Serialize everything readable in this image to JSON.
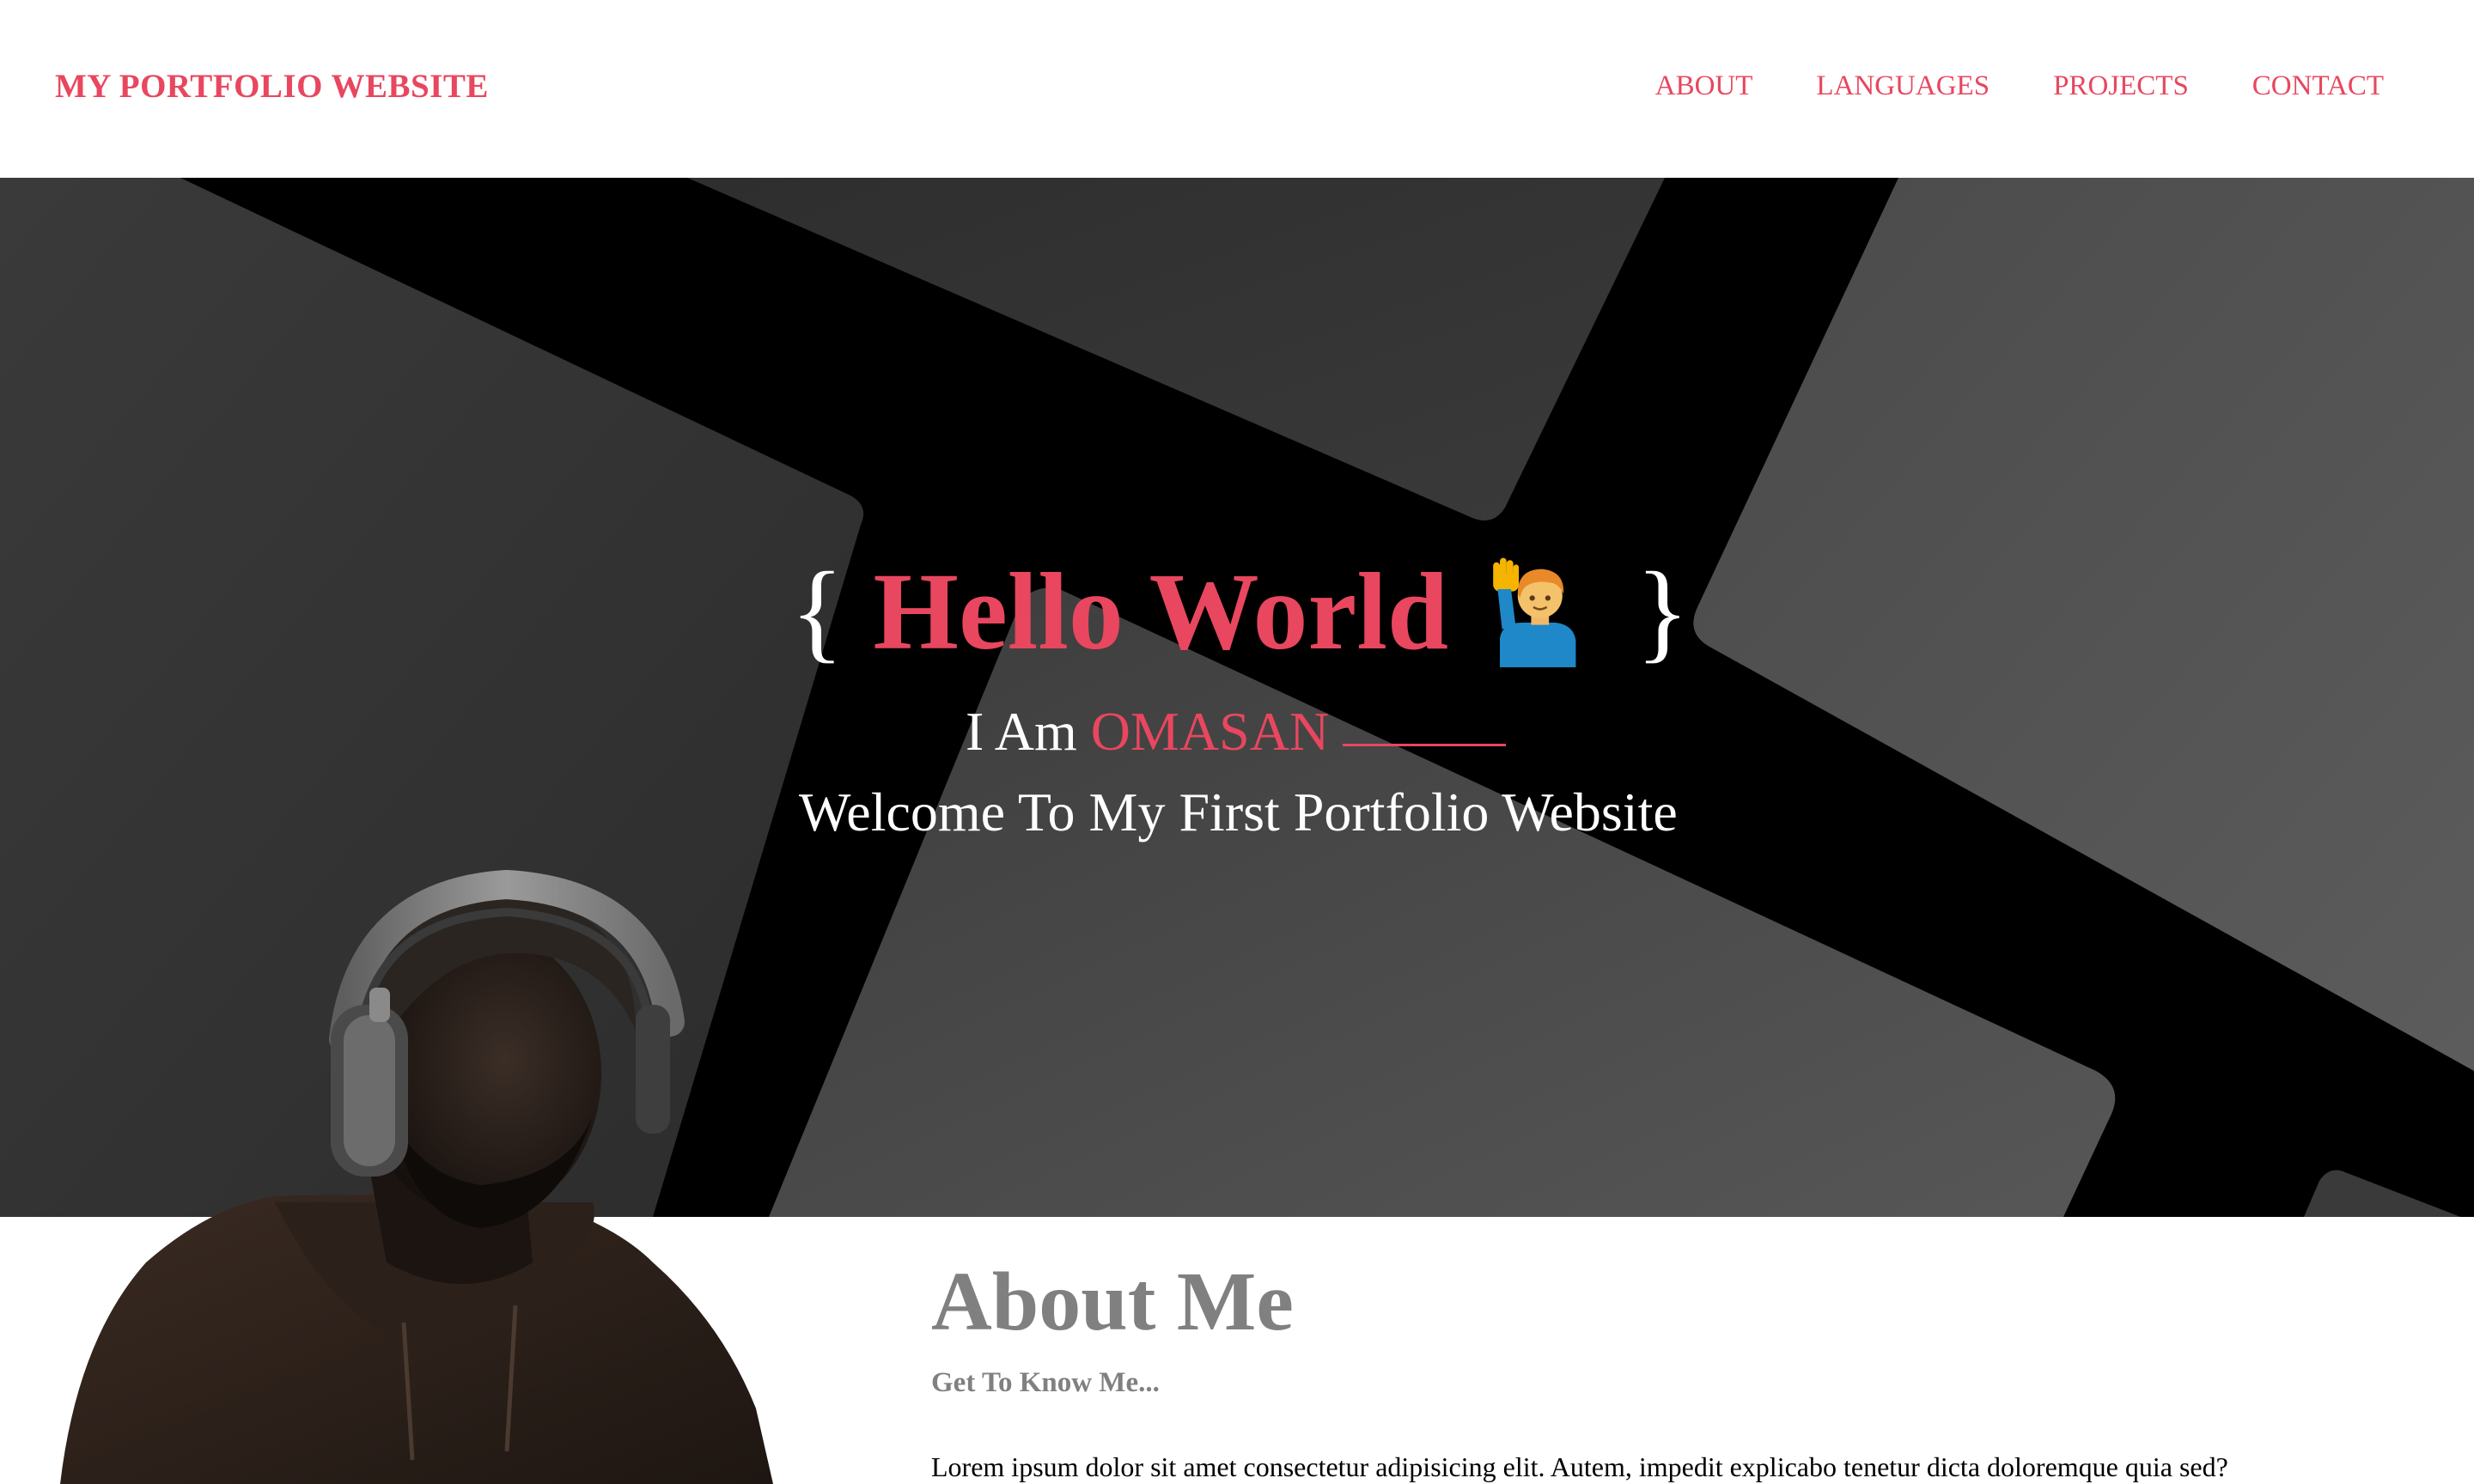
{
  "header": {
    "brand": "MY PORTFOLIO WEBSITE",
    "nav": [
      "ABOUT",
      "LANGUAGES",
      "PROJECTS",
      "CONTACT"
    ]
  },
  "hero": {
    "brace_open": "{",
    "hello": "Hello World",
    "wave_icon": "person-raising-hand-icon",
    "brace_close": "}",
    "iam_prefix": "I Am ",
    "name": "OMASAN",
    "welcome": "Welcome To My First Portfolio Website"
  },
  "about": {
    "title": "About Me",
    "subtitle": "Get To Know Me...",
    "text": "Lorem ipsum dolor sit amet consectetur adipisicing elit. Autem, impedit explicabo tenetur dicta doloremque quia sed?"
  },
  "colors": {
    "accent": "#e8475f",
    "hero_bg": "#000000",
    "muted_heading": "#808080"
  }
}
